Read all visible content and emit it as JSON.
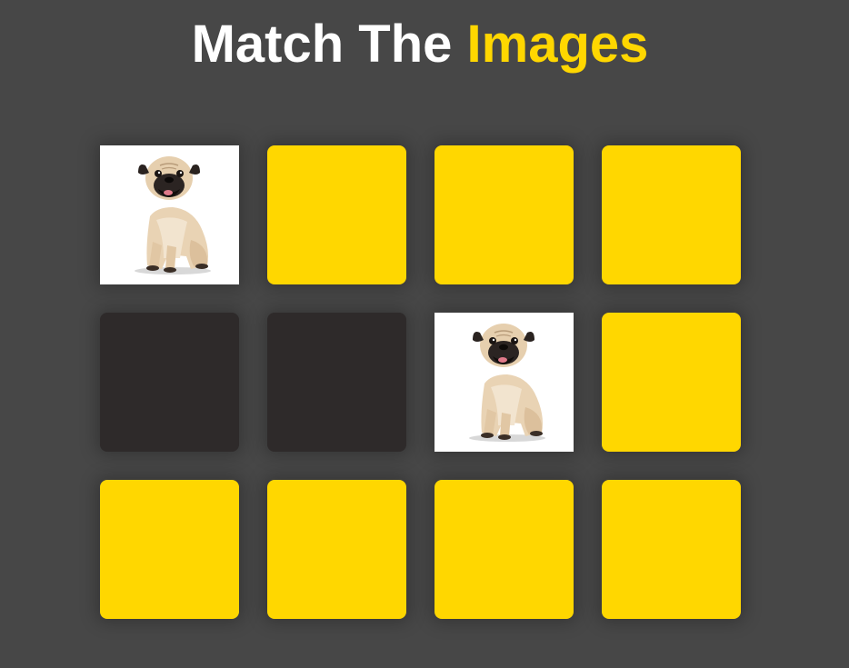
{
  "title": {
    "main": "Match The",
    "accent": "Images"
  },
  "colors": {
    "background": "#474747",
    "accent": "#ffd700",
    "card_back": "#ffd700",
    "card_matched": "#2e2a2a",
    "title_text": "#ffffff"
  },
  "board": {
    "rows": 3,
    "cols": 4,
    "cards": [
      {
        "state": "revealed",
        "image": "pug-dog-image"
      },
      {
        "state": "hidden"
      },
      {
        "state": "hidden"
      },
      {
        "state": "hidden"
      },
      {
        "state": "matched"
      },
      {
        "state": "matched"
      },
      {
        "state": "revealed",
        "image": "pug-dog-image"
      },
      {
        "state": "hidden"
      },
      {
        "state": "hidden"
      },
      {
        "state": "hidden"
      },
      {
        "state": "hidden"
      },
      {
        "state": "hidden"
      }
    ]
  }
}
